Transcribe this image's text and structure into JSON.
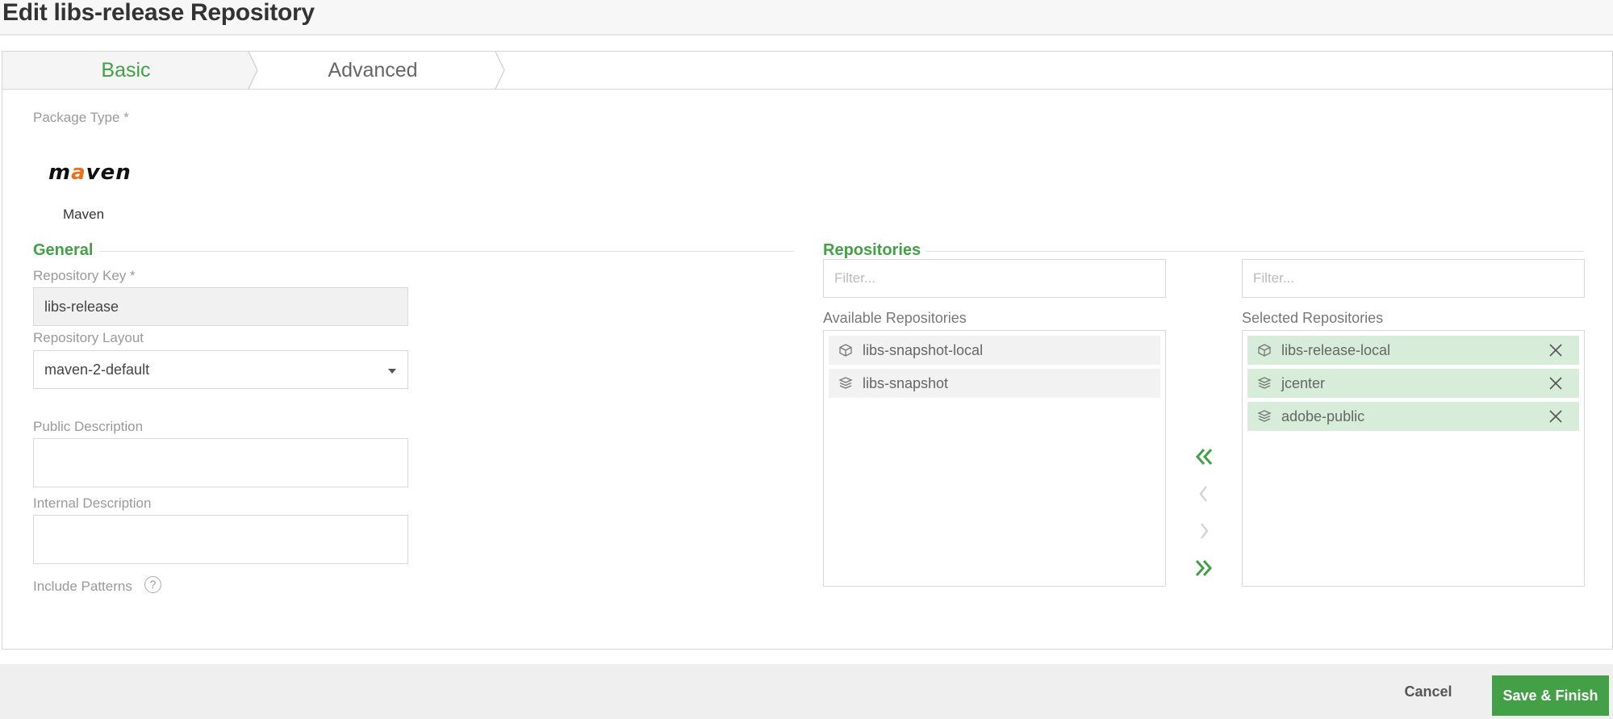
{
  "page": {
    "title": "Edit libs-release Repository"
  },
  "tabs": [
    {
      "label": "Basic",
      "active": true
    },
    {
      "label": "Advanced",
      "active": false
    }
  ],
  "package": {
    "label": "Package Type *",
    "logo_text_pre": "m",
    "logo_text_accent": "a",
    "logo_text_post": "ven",
    "name": "Maven"
  },
  "general": {
    "title": "General",
    "repo_key_label": "Repository Key *",
    "repo_key_value": "libs-release",
    "layout_label": "Repository Layout",
    "layout_value": "maven-2-default",
    "public_desc_label": "Public Description",
    "internal_desc_label": "Internal Description",
    "include_patterns_label": "Include Patterns",
    "help_glyph": "?"
  },
  "repositories": {
    "title": "Repositories",
    "filter_placeholder": "Filter...",
    "available_label": "Available Repositories",
    "selected_label": "Selected Repositories",
    "available": [
      {
        "name": "libs-snapshot-local",
        "icon": "box-icon"
      },
      {
        "name": "libs-snapshot",
        "icon": "stack-icon"
      }
    ],
    "selected": [
      {
        "name": "libs-release-local",
        "icon": "box-icon"
      },
      {
        "name": "jcenter",
        "icon": "stack-icon"
      },
      {
        "name": "adobe-public",
        "icon": "stack-icon"
      }
    ],
    "movers": [
      "«",
      "‹",
      "›",
      "»"
    ]
  },
  "footer": {
    "cancel_label": "Cancel",
    "save_label": "Save & Finish"
  },
  "colors": {
    "accent": "#43a047",
    "selected_bg": "#d7ecd9",
    "maven_accent": "#e8711f"
  }
}
